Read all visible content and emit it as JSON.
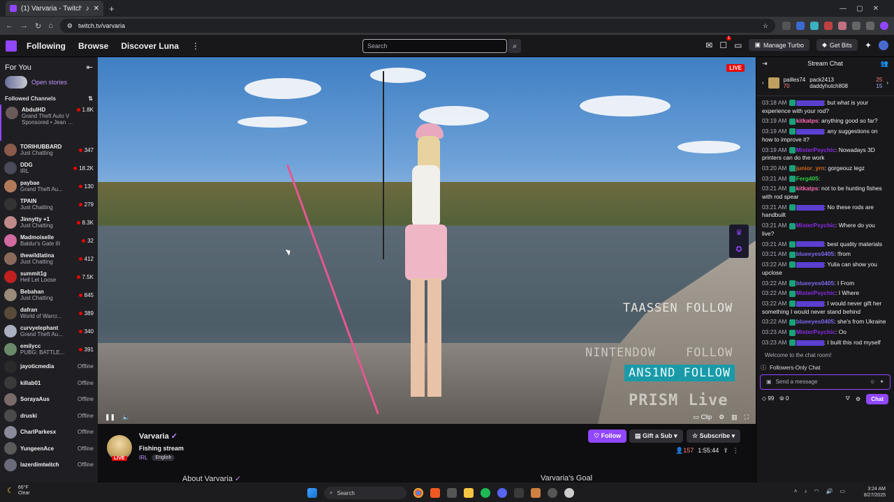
{
  "browser": {
    "tab_title": "(1) Varvaria - Twitch",
    "url": "twitch.tv/varvaria"
  },
  "topnav": {
    "links": [
      "Following",
      "Browse",
      "Discover Luna"
    ],
    "search_placeholder": "Search",
    "manage_turbo": "Manage Turbo",
    "get_bits": "Get Bits",
    "notif_count": "1"
  },
  "sidebar": {
    "for_you": "For You",
    "open_stories": "Open stories",
    "followed_channels": "Followed Channels",
    "featured": {
      "name": "AbdulHD",
      "game": "Grand Theft Auto V",
      "sponsored": "Sponsored •",
      "sponsor_name": "Jean Paul ...",
      "viewers": "1.8K"
    },
    "channels": [
      {
        "name": "TORIHUBBARD",
        "game": "Just Chatting",
        "viewers": "347",
        "color": "#8a5a4a"
      },
      {
        "name": "DDG",
        "game": "IRL",
        "viewers": "18.2K",
        "color": "#4a4a5a"
      },
      {
        "name": "paybae",
        "game": "Grand Theft Au...",
        "viewers": "130",
        "color": "#b07a5a"
      },
      {
        "name": "TPAIN",
        "game": "Just Chatting",
        "viewers": "279",
        "color": "#333"
      },
      {
        "name": "Jinnytty +1",
        "game": "Just Chatting",
        "viewers": "8.3K",
        "color": "#c08a8a"
      },
      {
        "name": "Madmoiselle",
        "game": "Baldur's Gate III",
        "viewers": "32",
        "color": "#d06aa0"
      },
      {
        "name": "thewildlatina",
        "game": "Just Chatting",
        "viewers": "412",
        "color": "#8a6a5a"
      },
      {
        "name": "summit1g",
        "game": "Hell Let Loose",
        "viewers": "7.5K",
        "color": "#c02020"
      },
      {
        "name": "Bebahan",
        "game": "Just Chatting",
        "viewers": "845",
        "color": "#9a8a7a"
      },
      {
        "name": "dafran",
        "game": "World of Warcr...",
        "viewers": "389",
        "color": "#5a4a3a"
      },
      {
        "name": "curvyelephant",
        "game": "Grand Theft Au...",
        "viewers": "340",
        "color": "#aab0c0"
      },
      {
        "name": "emilycc",
        "game": "PUBG: BATTLE...",
        "viewers": "391",
        "color": "#6a8a6a"
      }
    ],
    "offline": [
      {
        "name": "jayoticmedia",
        "status": "Offline",
        "color": "#2a2a2a"
      },
      {
        "name": "killab01",
        "status": "Offline",
        "color": "#3a3a3a"
      },
      {
        "name": "SorayaAus",
        "status": "Offline",
        "color": "#7a6a6a"
      },
      {
        "name": "druski",
        "status": "Offline",
        "color": "#4a4a4a"
      },
      {
        "name": "CharlParkesx",
        "status": "Offline",
        "color": "#8a8a9a"
      },
      {
        "name": "YungeenAce",
        "status": "Offline",
        "color": "#5a5a5a"
      },
      {
        "name": "lazerdimtwitch",
        "status": "Offline",
        "color": "#6a6a7a"
      }
    ]
  },
  "video": {
    "live": "LIVE",
    "overlay_1": "TAASSEN FOLLOW",
    "overlay_2a": "NINTENDOW",
    "overlay_2b": "FOLLOW",
    "overlay_3": "ANS1ND FOLLOW",
    "overlay_4": "PRISM Live",
    "clip": "Clip"
  },
  "stream_info": {
    "channel": "Varvaria",
    "title": "Fishing stream",
    "category": "IRL",
    "tag": "English",
    "live": "LIVE",
    "follow": "Follow",
    "gift": "Gift a Sub",
    "subscribe": "Subscribe",
    "viewers": "157",
    "uptime": "1:55:44",
    "about": "About Varvaria",
    "goal": "Varvaria's Goal"
  },
  "chat": {
    "title": "Stream Chat",
    "gifter_1": "pailles74",
    "gifter_1_count": "70",
    "gifter_2": "pack2413",
    "gifter_2_count": "25",
    "gifter_3": "daddyhutch808",
    "gifter_3_count": "15",
    "messages": [
      {
        "time": "03:18 AM",
        "user": "",
        "color": "#5a3fd0",
        "text": ": but what is your experience with your rod?"
      },
      {
        "time": "03:19 AM",
        "user": "kitkatps",
        "color": "#ff69b4",
        "text": ": anything good so far?"
      },
      {
        "time": "03:19 AM",
        "user": "",
        "color": "#5a3fd0",
        "text": ": any suggestions on how to improve it?"
      },
      {
        "time": "03:19 AM",
        "user": "MisterPsychic",
        "color": "#8a2be2",
        "text": ": Nowadays 3D printers can do the work"
      },
      {
        "time": "03:20 AM",
        "user": "junior_yrn",
        "color": "#d2691e",
        "text": ": gorgeouz legz"
      },
      {
        "time": "03:21 AM",
        "user": "Ferg405",
        "color": "#2ecc40",
        "text": ":"
      },
      {
        "time": "03:21 AM",
        "user": "kitkatps",
        "color": "#ff69b4",
        "text": ": not to be hunting fishes with rod spear"
      },
      {
        "time": "03:21 AM",
        "user": "",
        "color": "#5a3fd0",
        "text": ": No these rods are handbuilt"
      },
      {
        "time": "03:21 AM",
        "user": "MisterPsychic",
        "color": "#8a2be2",
        "text": ": Where do you live?"
      },
      {
        "time": "03:21 AM",
        "user": "",
        "color": "#5a3fd0",
        "text": ": best quality materials"
      },
      {
        "time": "03:21 AM",
        "user": "blueeyes0405",
        "color": "#7b68ee",
        "text": ": !from"
      },
      {
        "time": "03:22 AM",
        "user": "",
        "color": "#5a3fd0",
        "text": ": Yulia can show you upclose"
      },
      {
        "time": "03:22 AM",
        "user": "blueeyes0405",
        "color": "#7b68ee",
        "text": ": I From"
      },
      {
        "time": "03:22 AM",
        "user": "MisterPsychic",
        "color": "#8a2be2",
        "text": ": I Where"
      },
      {
        "time": "03:22 AM",
        "user": "",
        "color": "#5a3fd0",
        "text": ": I would never gift her something I would never stand behind"
      },
      {
        "time": "03:22 AM",
        "user": "blueeyes0405",
        "color": "#7b68ee",
        "text": ": she's from Ukraine"
      },
      {
        "time": "03:23 AM",
        "user": "MisterPsychic",
        "color": "#8a2be2",
        "text": ": Oo"
      },
      {
        "time": "03:23 AM",
        "user": "",
        "color": "#5a3fd0",
        "text": ": I built this rod myself"
      }
    ],
    "welcome": "Welcome to the chat room!",
    "followers_only": "Followers-Only Chat",
    "send_placeholder": "Send a message",
    "bits": "99",
    "points": "0",
    "chat_button": "Chat"
  },
  "taskbar": {
    "temp": "66°F",
    "weather": "Clear",
    "search": "Search",
    "time": "3:24 AM",
    "date": "8/27/2025"
  }
}
